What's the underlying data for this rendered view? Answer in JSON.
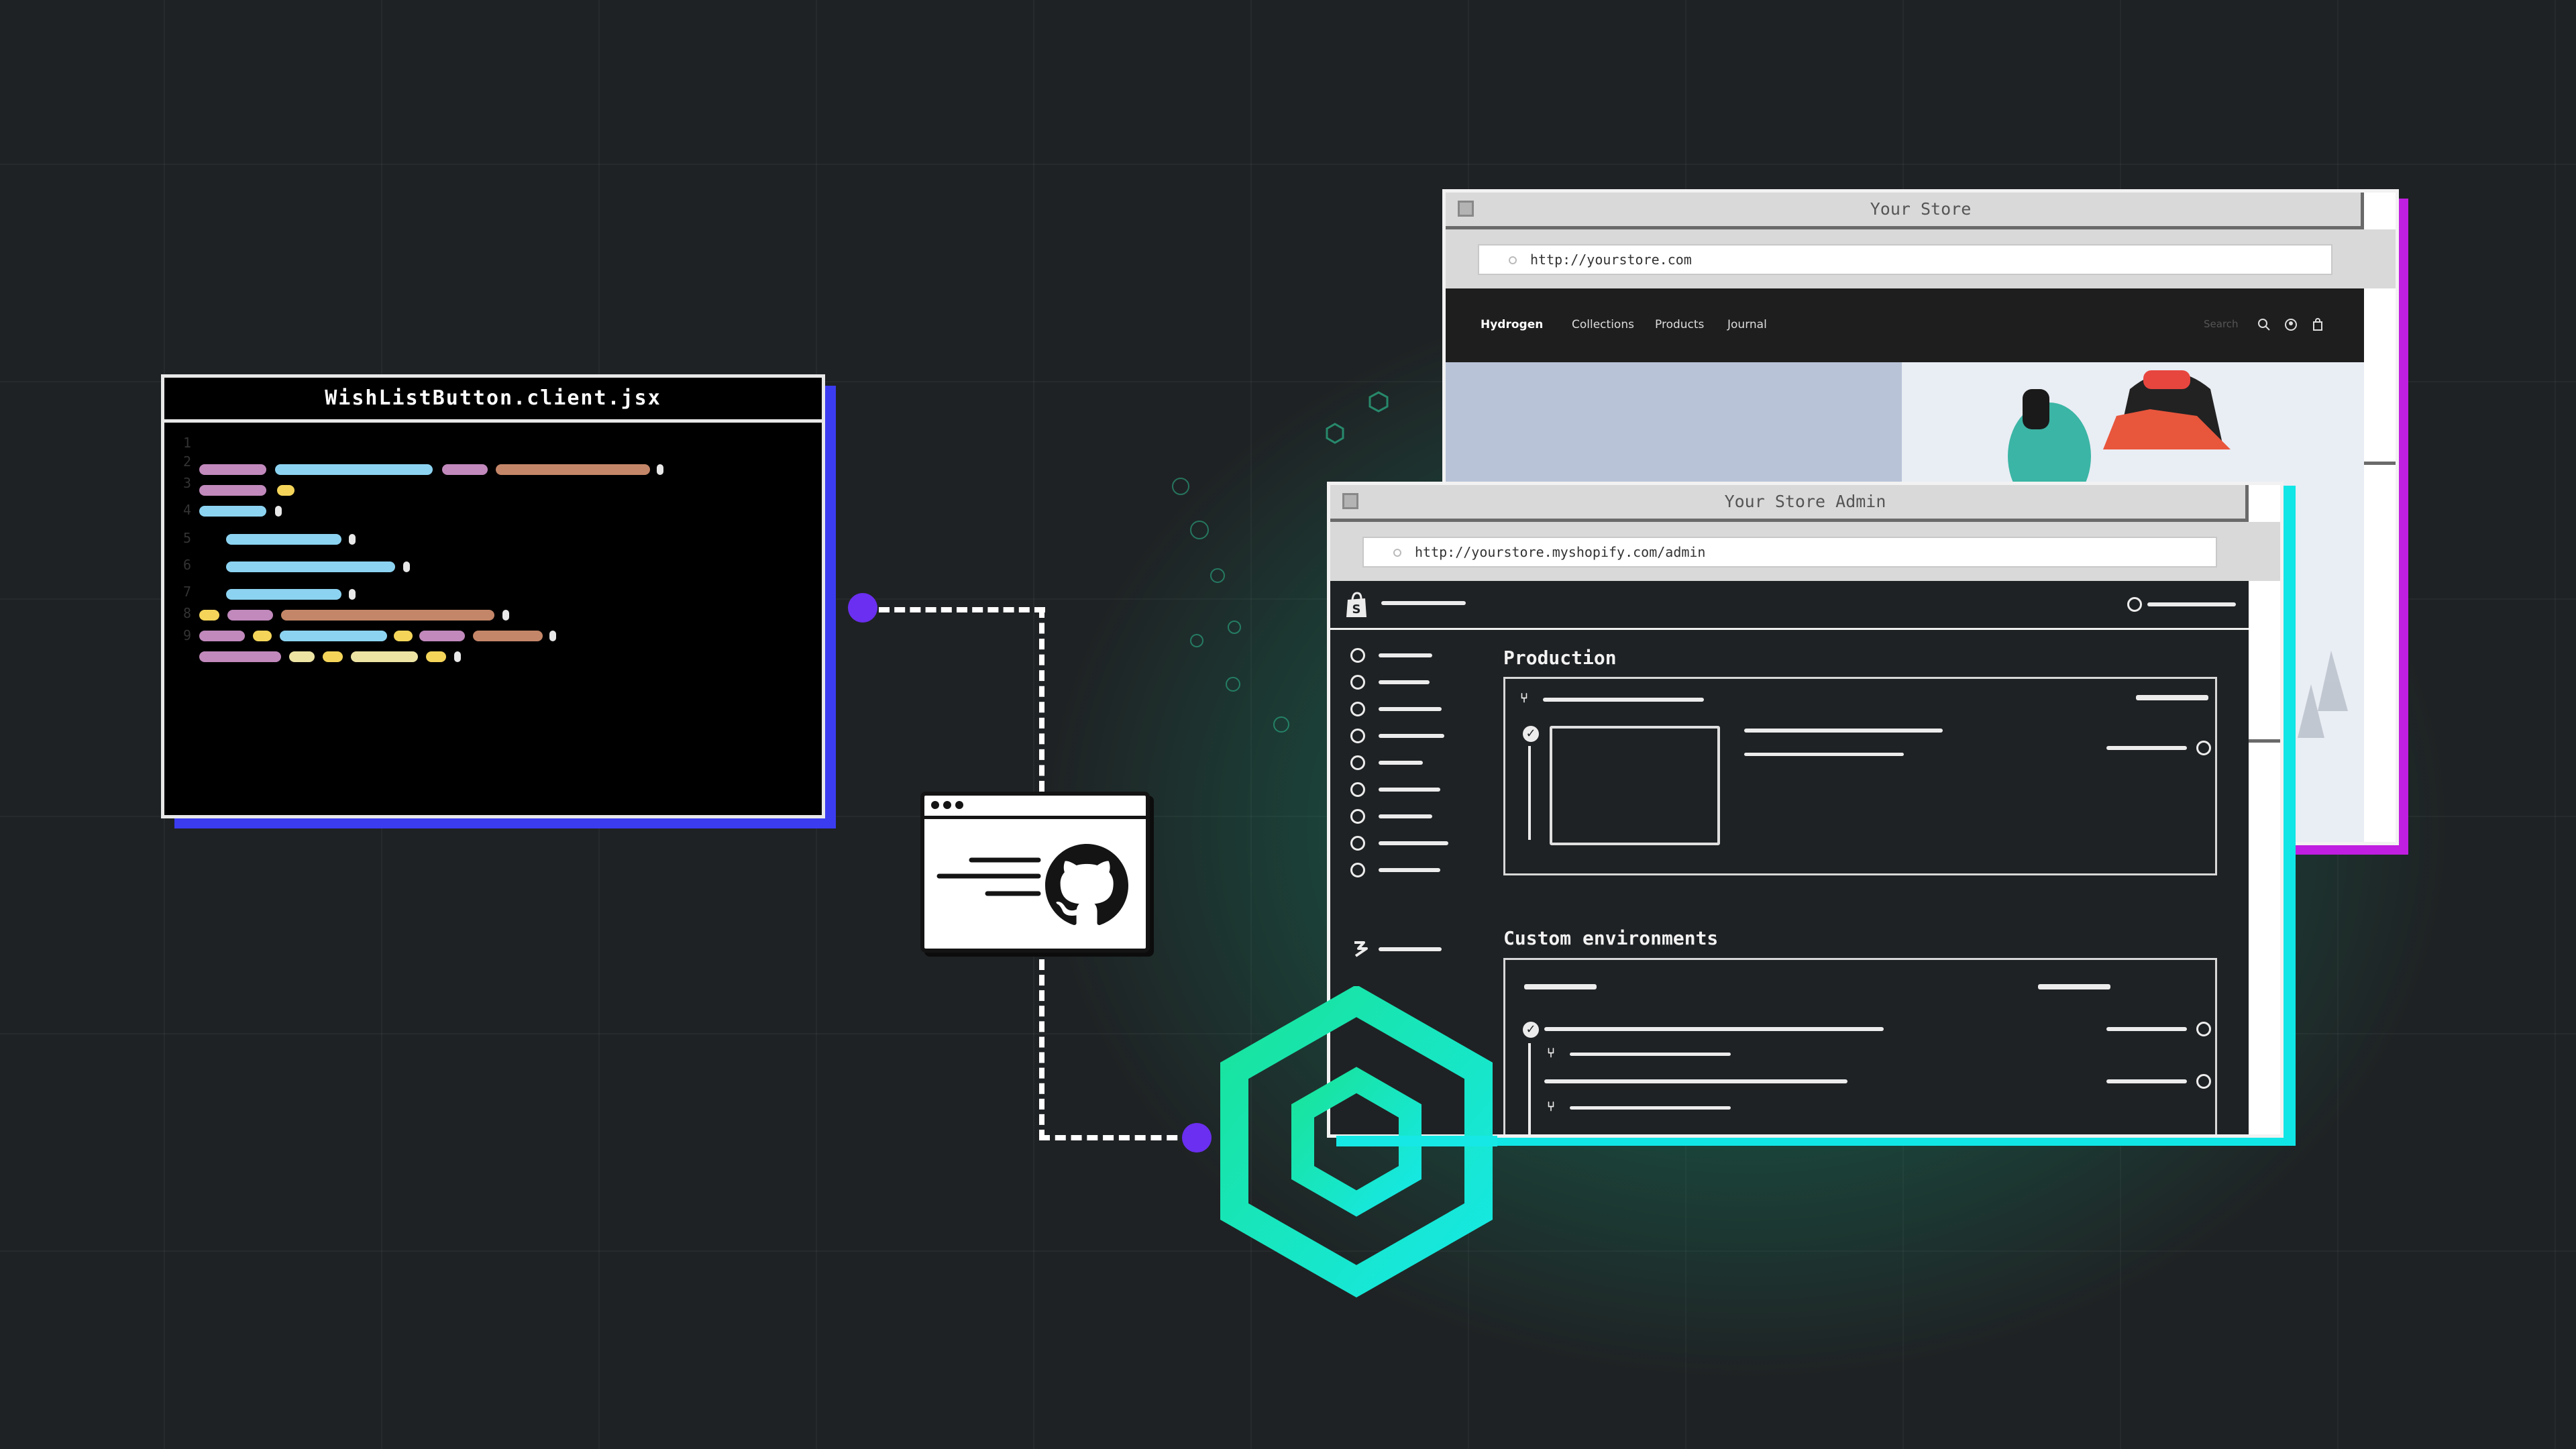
{
  "code_window": {
    "filename": "WishListButton.client.jsx",
    "line_numbers": [
      "1",
      "2",
      "3",
      "4",
      "5",
      "6",
      "7",
      "8",
      "9"
    ]
  },
  "store_window": {
    "title": "Your Store",
    "url": "http://yourstore.com",
    "nav": {
      "brand": "Hydrogen",
      "links": [
        "Collections",
        "Products",
        "Journal"
      ],
      "search_placeholder": "Search"
    }
  },
  "admin_window": {
    "title": "Your Store Admin",
    "url": "http://yourstore.myshopify.com/admin",
    "sections": {
      "production": "Production",
      "custom": "Custom environments"
    }
  },
  "colors": {
    "code_shadow": "#3b3cf0",
    "store_shadow": "#c01ee0",
    "admin_shadow": "#11e6e6",
    "oxygen_hex": "#12e6b0",
    "connector_dot": "#6a2ff0"
  },
  "icons": [
    "github-icon",
    "shopify-bag-icon",
    "oxygen-hexagon-logo",
    "search-icon",
    "account-icon",
    "cart-icon",
    "branch-icon"
  ]
}
